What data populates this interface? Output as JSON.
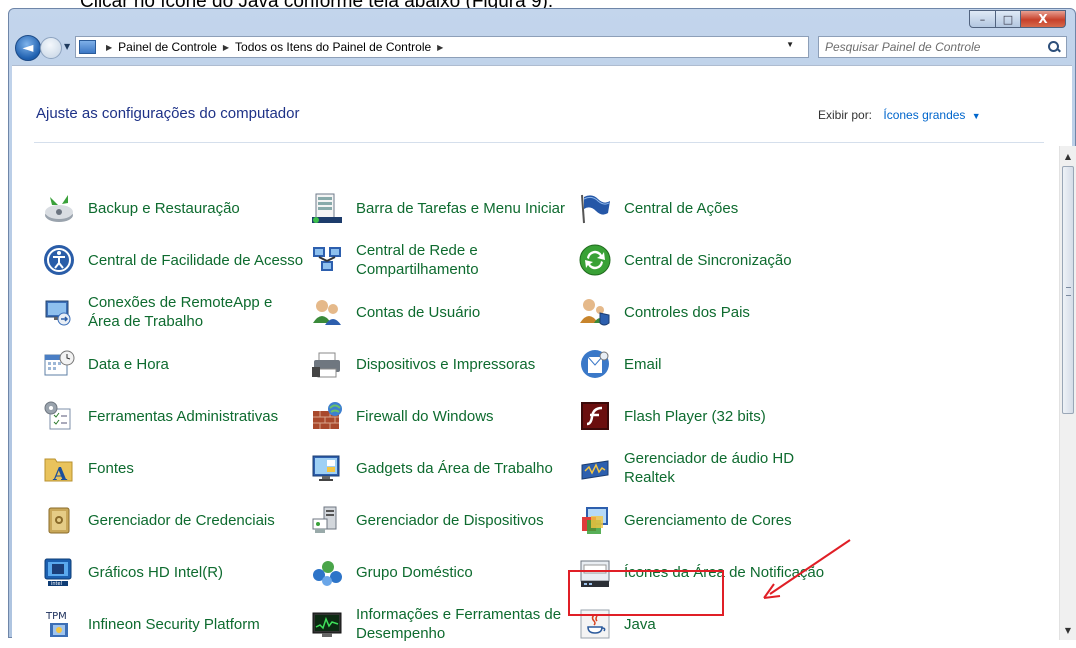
{
  "caption": "Clicar no ícone do Java conforme tela abaixo (Figura 9).",
  "window": {
    "buttons": {
      "minimize": "–",
      "maximize": "□",
      "close": "X"
    }
  },
  "nav": {
    "breadcrumbs": [
      "Painel de Controle",
      "Todos os Itens do Painel de Controle"
    ],
    "search_placeholder": "Pesquisar Painel de Controle"
  },
  "header": {
    "title": "Ajuste as configurações do computador",
    "view_by_label": "Exibir por:",
    "view_by_value": "Ícones grandes"
  },
  "items": [
    {
      "label": "Backup e Restauração",
      "icon": "backup-icon"
    },
    {
      "label": "Barra de Tarefas e Menu Iniciar",
      "icon": "taskbar-icon"
    },
    {
      "label": "Central de Ações",
      "icon": "action-center-flag-icon"
    },
    {
      "label": "Central de Facilidade de Acesso",
      "icon": "ease-of-access-icon"
    },
    {
      "label": "Central de Rede e Compartilhamento",
      "icon": "network-icon"
    },
    {
      "label": "Central de Sincronização",
      "icon": "sync-center-icon"
    },
    {
      "label": "Conexões de RemoteApp e Área de Trabalho",
      "icon": "remoteapp-icon"
    },
    {
      "label": "Contas de Usuário",
      "icon": "user-accounts-icon"
    },
    {
      "label": "Controles dos Pais",
      "icon": "parental-controls-icon"
    },
    {
      "label": "Data e Hora",
      "icon": "calendar-clock-icon"
    },
    {
      "label": "Dispositivos e Impressoras",
      "icon": "printer-icon"
    },
    {
      "label": "Email",
      "icon": "email-icon"
    },
    {
      "label": "Ferramentas Administrativas",
      "icon": "admin-tools-icon"
    },
    {
      "label": "Firewall do Windows",
      "icon": "firewall-icon"
    },
    {
      "label": "Flash Player (32 bits)",
      "icon": "flash-icon"
    },
    {
      "label": "Fontes",
      "icon": "fonts-folder-icon"
    },
    {
      "label": "Gadgets da Área de Trabalho",
      "icon": "gadgets-icon"
    },
    {
      "label": "Gerenciador de áudio HD Realtek",
      "icon": "realtek-audio-icon"
    },
    {
      "label": "Gerenciador de Credenciais",
      "icon": "credential-vault-icon"
    },
    {
      "label": "Gerenciador de Dispositivos",
      "icon": "device-manager-icon"
    },
    {
      "label": "Gerenciamento de Cores",
      "icon": "color-management-icon"
    },
    {
      "label": "Gráficos HD Intel(R)",
      "icon": "intel-graphics-icon"
    },
    {
      "label": "Grupo Doméstico",
      "icon": "homegroup-icon"
    },
    {
      "label": "Ícones da Área de Notificação",
      "icon": "notification-area-icon"
    },
    {
      "label": "Infineon Security Platform",
      "icon": "tpm-icon"
    },
    {
      "label": "Informações e Ferramentas de Desempenho",
      "icon": "performance-icon"
    },
    {
      "label": "Java",
      "icon": "java-icon"
    }
  ],
  "tpm_text": "TPM",
  "colors": {
    "link": "#0e6b2f",
    "title": "#1e3287",
    "highlight": "#e01f26"
  }
}
